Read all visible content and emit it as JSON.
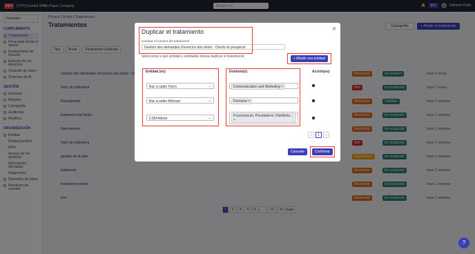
{
  "topbar": {
    "logo": "DEV",
    "company": "[CPO] Dunder Mifflin Paper Company",
    "search_placeholder": "Busque en",
    "env_badge": "dev",
    "user": "Clément Potel"
  },
  "sidebar": {
    "favorites": "Favoritos",
    "sections": [
      {
        "header": "CUMPLIMIENTO",
        "items": [
          "Tratamientos",
          "Privacidad desde el diseño",
          "Evaluaciones de impacto",
          "Ejercicio de los derechos",
          "Violación de datos",
          "Sistemas de IA"
        ]
      },
      {
        "header": "GESTIÓN",
        "items": [
          "Acciones",
          "Registro",
          "Cartografía",
          "Auditorías",
          "Analítica"
        ]
      },
      {
        "header": "ORGANIZACIÓN",
        "items": [
          "Entidad",
          "Entidad jurídica",
          "RPD",
          "Acceso de los usuarios",
          "Direcciones afectadas",
          "Diagnóstico",
          "Depósitos de datos",
          "Rendición de cuentas"
        ]
      }
    ]
  },
  "main": {
    "breadcrumb": "Privacy Cockpit / Tratamientos",
    "title": "Tratamientos",
    "cartography_btn": "Cartografía",
    "add_btn": "+ Añadir un tratamiento",
    "search_placeholder": "Todos los tratamientos",
    "filters": [
      "Tipo",
      "Áreas",
      "Finalización Estándar"
    ],
    "columns": [
      "Tratamiento",
      "Sensibilidad identificada",
      "Estatus",
      "Actualizado"
    ],
    "rows": [
      {
        "name": "Gestion des demandes d'exercice des droits - Clients et prospects",
        "sens": "Moderado",
        "sens_color": "#e06b1f",
        "status": "En revisión",
        "updated": "hace 5 horas"
      },
      {
        "name": "Nom du traitement",
        "sens": "Alto",
        "sens_color": "#d32f2f",
        "status": "En redacción",
        "updated": "hace 7 horas"
      },
      {
        "name": "Recrutement",
        "sens": "Moderado",
        "sens_color": "#e06b1f",
        "status": "Validado",
        "updated": "hace 1 semana"
      },
      {
        "name": "traitement test kouki",
        "sens": "Moderado",
        "sens_color": "#e06b1f",
        "status": "En redacción",
        "updated": "hace 1 semana"
      },
      {
        "name": "Recrutement",
        "sens": "Moderado",
        "sens_color": "#e06b1f",
        "status": "En redacción",
        "updated": "hace 1 semana"
      },
      {
        "name": "Nom du traitement",
        "sens": "Alto",
        "sens_color": "#d32f2f",
        "status": "En redacción",
        "updated": "hace 1 semana"
      },
      {
        "name": "gestion de la paie",
        "sens": "Significativo",
        "sens_color": "#f2a300",
        "status": "En redacción",
        "updated": "hace 1 semana"
      },
      {
        "name": "traitement",
        "sens": "Moderado",
        "sens_color": "#e06b1f",
        "status": "En redacción",
        "updated": "hace 1 semana"
      },
      {
        "name": "traitement conseil",
        "sens": "Moderado",
        "sens_color": "#e06b1f",
        "status": "En redacción",
        "updated": "hace 1 semana"
      },
      {
        "name": "test",
        "sens": "Moderado",
        "sens_color": "#e06b1f",
        "status": "En redacción",
        "updated": "hace 1 semana"
      }
    ],
    "pager": [
      "1",
      "2",
      "3",
      "4",
      "5",
      "...",
      "12"
    ],
    "per_page": "10 / page"
  },
  "dialog": {
    "title": "Duplicar el tratamiento",
    "name_label": "Cambiar el nombre del tratamiento",
    "name_value": "Gestion des demandes d'exercice des droits - Clients et prospects",
    "description": "Seleccione a qué entidad o entidades desea duplicar el tratamiento",
    "add_entity_btn": "+ Añadir una entidad",
    "col_entity": "Entidad (es)",
    "col_domain": "Dominio(s)",
    "col_action": "Acción(es)",
    "entities": [
      "Bac à sable Flynn",
      "Bac à sable Michael",
      "CSM Admin"
    ],
    "domains": [
      "Communication and Marketing",
      "Domaine",
      "Fournisseurs, Prestataires, Distribute..."
    ],
    "page": "1",
    "cancel_btn": "Cancelar",
    "confirm_btn": "Confirmar"
  }
}
